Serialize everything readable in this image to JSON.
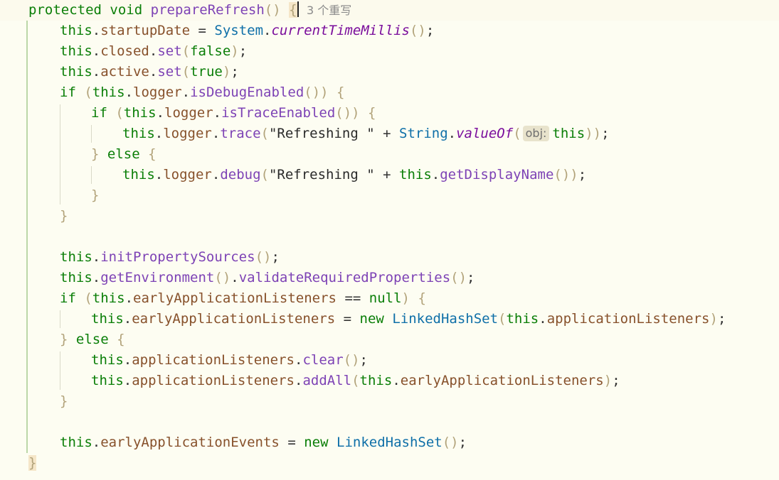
{
  "editor": {
    "language": "java",
    "method_signature": "protected void prepareRefresh()",
    "usages_hint": "3 个重写",
    "colors": {
      "background": "#fdfdf2",
      "keyword": "#0a7e07",
      "field": "#87512b",
      "method": "#7d42b5",
      "static_method": "#7a0d9c",
      "class": "#0e6fa8",
      "string": "#2a2a2a",
      "punctuation": "#333333",
      "paren": "#b2a37a",
      "indent_guide": "#d9d9c8",
      "gutter_line": "#bcd7a8",
      "hint_background": "#e8e3cc",
      "current_line": "#fcfaed"
    },
    "lines": [
      {
        "indent": 0,
        "tokens": [
          {
            "t": "kw",
            "v": "protected"
          },
          {
            "t": "plain",
            "v": " "
          },
          {
            "t": "kw",
            "v": "void"
          },
          {
            "t": "plain",
            "v": " "
          },
          {
            "t": "method",
            "v": "prepareRefresh"
          },
          {
            "t": "paren",
            "v": "()"
          },
          {
            "t": "plain",
            "v": " "
          },
          {
            "t": "bracehl",
            "v": "{"
          },
          {
            "t": "caret",
            "v": ""
          },
          {
            "t": "plain",
            "v": " "
          },
          {
            "t": "usage",
            "v": "3 个重写"
          }
        ]
      },
      {
        "indent": 1,
        "tokens": [
          {
            "t": "kw",
            "v": "this"
          },
          {
            "t": "plain",
            "v": "."
          },
          {
            "t": "field",
            "v": "startupDate"
          },
          {
            "t": "plain",
            "v": " = "
          },
          {
            "t": "class",
            "v": "System"
          },
          {
            "t": "plain",
            "v": "."
          },
          {
            "t": "static",
            "v": "currentTimeMillis"
          },
          {
            "t": "paren",
            "v": "()"
          },
          {
            "t": "plain",
            "v": ";"
          }
        ]
      },
      {
        "indent": 1,
        "tokens": [
          {
            "t": "kw",
            "v": "this"
          },
          {
            "t": "plain",
            "v": "."
          },
          {
            "t": "field",
            "v": "closed"
          },
          {
            "t": "plain",
            "v": "."
          },
          {
            "t": "method",
            "v": "set"
          },
          {
            "t": "paren",
            "v": "("
          },
          {
            "t": "kw",
            "v": "false"
          },
          {
            "t": "paren",
            "v": ")"
          },
          {
            "t": "plain",
            "v": ";"
          }
        ]
      },
      {
        "indent": 1,
        "tokens": [
          {
            "t": "kw",
            "v": "this"
          },
          {
            "t": "plain",
            "v": "."
          },
          {
            "t": "field",
            "v": "active"
          },
          {
            "t": "plain",
            "v": "."
          },
          {
            "t": "method",
            "v": "set"
          },
          {
            "t": "paren",
            "v": "("
          },
          {
            "t": "kw",
            "v": "true"
          },
          {
            "t": "paren",
            "v": ")"
          },
          {
            "t": "plain",
            "v": ";"
          }
        ]
      },
      {
        "indent": 1,
        "tokens": [
          {
            "t": "kw",
            "v": "if"
          },
          {
            "t": "plain",
            "v": " "
          },
          {
            "t": "paren",
            "v": "("
          },
          {
            "t": "kw",
            "v": "this"
          },
          {
            "t": "plain",
            "v": "."
          },
          {
            "t": "field",
            "v": "logger"
          },
          {
            "t": "plain",
            "v": "."
          },
          {
            "t": "method",
            "v": "isDebugEnabled"
          },
          {
            "t": "paren",
            "v": "())"
          },
          {
            "t": "plain",
            "v": " "
          },
          {
            "t": "paren",
            "v": "{"
          }
        ]
      },
      {
        "indent": 2,
        "tokens": [
          {
            "t": "kw",
            "v": "if"
          },
          {
            "t": "plain",
            "v": " "
          },
          {
            "t": "paren",
            "v": "("
          },
          {
            "t": "kw",
            "v": "this"
          },
          {
            "t": "plain",
            "v": "."
          },
          {
            "t": "field",
            "v": "logger"
          },
          {
            "t": "plain",
            "v": "."
          },
          {
            "t": "method",
            "v": "isTraceEnabled"
          },
          {
            "t": "paren",
            "v": "())"
          },
          {
            "t": "plain",
            "v": " "
          },
          {
            "t": "paren",
            "v": "{"
          }
        ]
      },
      {
        "indent": 3,
        "tokens": [
          {
            "t": "kw",
            "v": "this"
          },
          {
            "t": "plain",
            "v": "."
          },
          {
            "t": "field",
            "v": "logger"
          },
          {
            "t": "plain",
            "v": "."
          },
          {
            "t": "method",
            "v": "trace"
          },
          {
            "t": "paren",
            "v": "("
          },
          {
            "t": "string",
            "v": "\"Refreshing \""
          },
          {
            "t": "plain",
            "v": " + "
          },
          {
            "t": "class",
            "v": "String"
          },
          {
            "t": "plain",
            "v": "."
          },
          {
            "t": "static",
            "v": "valueOf"
          },
          {
            "t": "paren",
            "v": "("
          },
          {
            "t": "hint",
            "v": "obj:"
          },
          {
            "t": "kw",
            "v": "this"
          },
          {
            "t": "paren",
            "v": "))"
          },
          {
            "t": "plain",
            "v": ";"
          }
        ]
      },
      {
        "indent": 2,
        "tokens": [
          {
            "t": "paren",
            "v": "}"
          },
          {
            "t": "plain",
            "v": " "
          },
          {
            "t": "kw",
            "v": "else"
          },
          {
            "t": "plain",
            "v": " "
          },
          {
            "t": "paren",
            "v": "{"
          }
        ]
      },
      {
        "indent": 3,
        "tokens": [
          {
            "t": "kw",
            "v": "this"
          },
          {
            "t": "plain",
            "v": "."
          },
          {
            "t": "field",
            "v": "logger"
          },
          {
            "t": "plain",
            "v": "."
          },
          {
            "t": "method",
            "v": "debug"
          },
          {
            "t": "paren",
            "v": "("
          },
          {
            "t": "string",
            "v": "\"Refreshing \""
          },
          {
            "t": "plain",
            "v": " + "
          },
          {
            "t": "kw",
            "v": "this"
          },
          {
            "t": "plain",
            "v": "."
          },
          {
            "t": "method",
            "v": "getDisplayName"
          },
          {
            "t": "paren",
            "v": "())"
          },
          {
            "t": "plain",
            "v": ";"
          }
        ]
      },
      {
        "indent": 2,
        "tokens": [
          {
            "t": "paren",
            "v": "}"
          }
        ]
      },
      {
        "indent": 1,
        "tokens": [
          {
            "t": "paren",
            "v": "}"
          }
        ]
      },
      {
        "indent": 0,
        "tokens": []
      },
      {
        "indent": 1,
        "tokens": [
          {
            "t": "kw",
            "v": "this"
          },
          {
            "t": "plain",
            "v": "."
          },
          {
            "t": "method",
            "v": "initPropertySources"
          },
          {
            "t": "paren",
            "v": "()"
          },
          {
            "t": "plain",
            "v": ";"
          }
        ]
      },
      {
        "indent": 1,
        "tokens": [
          {
            "t": "kw",
            "v": "this"
          },
          {
            "t": "plain",
            "v": "."
          },
          {
            "t": "method",
            "v": "getEnvironment"
          },
          {
            "t": "paren",
            "v": "()"
          },
          {
            "t": "plain",
            "v": "."
          },
          {
            "t": "method",
            "v": "validateRequiredProperties"
          },
          {
            "t": "paren",
            "v": "()"
          },
          {
            "t": "plain",
            "v": ";"
          }
        ]
      },
      {
        "indent": 1,
        "tokens": [
          {
            "t": "kw",
            "v": "if"
          },
          {
            "t": "plain",
            "v": " "
          },
          {
            "t": "paren",
            "v": "("
          },
          {
            "t": "kw",
            "v": "this"
          },
          {
            "t": "plain",
            "v": "."
          },
          {
            "t": "field",
            "v": "earlyApplicationListeners"
          },
          {
            "t": "plain",
            "v": " == "
          },
          {
            "t": "kw",
            "v": "null"
          },
          {
            "t": "paren",
            "v": ")"
          },
          {
            "t": "plain",
            "v": " "
          },
          {
            "t": "paren",
            "v": "{"
          }
        ]
      },
      {
        "indent": 2,
        "tokens": [
          {
            "t": "kw",
            "v": "this"
          },
          {
            "t": "plain",
            "v": "."
          },
          {
            "t": "field",
            "v": "earlyApplicationListeners"
          },
          {
            "t": "plain",
            "v": " = "
          },
          {
            "t": "kw",
            "v": "new"
          },
          {
            "t": "plain",
            "v": " "
          },
          {
            "t": "class",
            "v": "LinkedHashSet"
          },
          {
            "t": "paren",
            "v": "("
          },
          {
            "t": "kw",
            "v": "this"
          },
          {
            "t": "plain",
            "v": "."
          },
          {
            "t": "field",
            "v": "applicationListeners"
          },
          {
            "t": "paren",
            "v": ")"
          },
          {
            "t": "plain",
            "v": ";"
          }
        ]
      },
      {
        "indent": 1,
        "tokens": [
          {
            "t": "paren",
            "v": "}"
          },
          {
            "t": "plain",
            "v": " "
          },
          {
            "t": "kw",
            "v": "else"
          },
          {
            "t": "plain",
            "v": " "
          },
          {
            "t": "paren",
            "v": "{"
          }
        ]
      },
      {
        "indent": 2,
        "tokens": [
          {
            "t": "kw",
            "v": "this"
          },
          {
            "t": "plain",
            "v": "."
          },
          {
            "t": "field",
            "v": "applicationListeners"
          },
          {
            "t": "plain",
            "v": "."
          },
          {
            "t": "method",
            "v": "clear"
          },
          {
            "t": "paren",
            "v": "()"
          },
          {
            "t": "plain",
            "v": ";"
          }
        ]
      },
      {
        "indent": 2,
        "tokens": [
          {
            "t": "kw",
            "v": "this"
          },
          {
            "t": "plain",
            "v": "."
          },
          {
            "t": "field",
            "v": "applicationListeners"
          },
          {
            "t": "plain",
            "v": "."
          },
          {
            "t": "method",
            "v": "addAll"
          },
          {
            "t": "paren",
            "v": "("
          },
          {
            "t": "kw",
            "v": "this"
          },
          {
            "t": "plain",
            "v": "."
          },
          {
            "t": "field",
            "v": "earlyApplicationListeners"
          },
          {
            "t": "paren",
            "v": ")"
          },
          {
            "t": "plain",
            "v": ";"
          }
        ]
      },
      {
        "indent": 1,
        "tokens": [
          {
            "t": "paren",
            "v": "}"
          }
        ]
      },
      {
        "indent": 0,
        "tokens": []
      },
      {
        "indent": 1,
        "tokens": [
          {
            "t": "kw",
            "v": "this"
          },
          {
            "t": "plain",
            "v": "."
          },
          {
            "t": "field",
            "v": "earlyApplicationEvents"
          },
          {
            "t": "plain",
            "v": " = "
          },
          {
            "t": "kw",
            "v": "new"
          },
          {
            "t": "plain",
            "v": " "
          },
          {
            "t": "class",
            "v": "LinkedHashSet"
          },
          {
            "t": "paren",
            "v": "()"
          },
          {
            "t": "plain",
            "v": ";"
          }
        ]
      },
      {
        "indent": 0,
        "tokens": [
          {
            "t": "bracehl",
            "v": "}"
          }
        ]
      }
    ]
  }
}
